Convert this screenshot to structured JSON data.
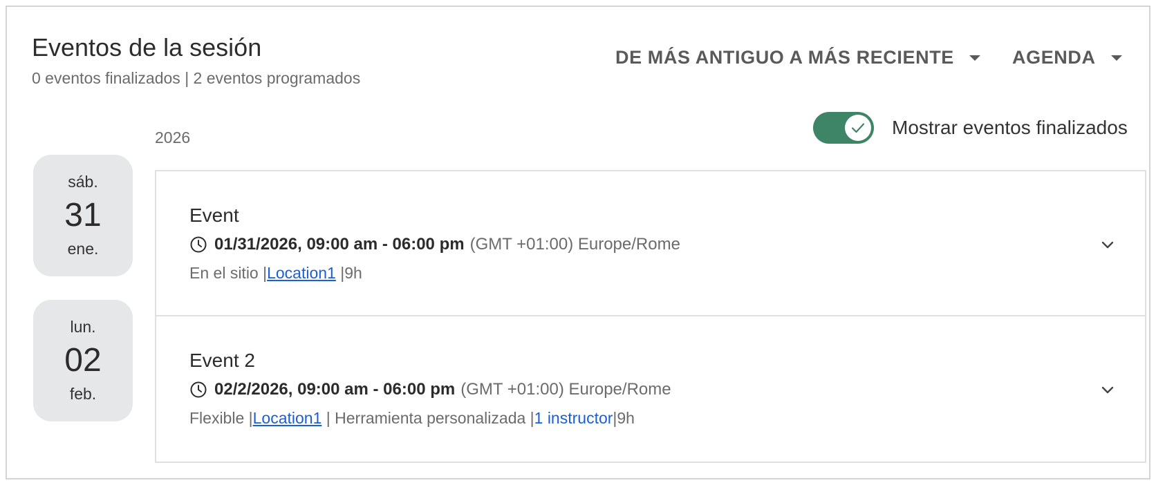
{
  "header": {
    "title": "Eventos de la sesión",
    "subtitle": "0 eventos finalizados | 2 eventos programados",
    "sort_label": "DE MÁS ANTIGUO A MÁS RECIENTE",
    "view_label": "AGENDA"
  },
  "toggle": {
    "label": "Mostrar eventos finalizados",
    "on": true,
    "color": "#3d8566"
  },
  "year": "2026",
  "colors": {
    "link": "#1a5fd6",
    "tile_bg": "#e6e7e8"
  },
  "events": [
    {
      "dow": "sáb.",
      "day": "31",
      "month": "ene.",
      "name": "Event",
      "datetime": "01/31/2026, 09:00 am - 06:00 pm",
      "timezone": "(GMT +01:00) Europe/Rome",
      "mode": "En el sitio |",
      "location": "Location1",
      "sep1": " |",
      "duration": "9h",
      "icon": "clock-icon"
    },
    {
      "dow": "lun.",
      "day": "02",
      "month": "feb.",
      "name": "Event 2",
      "datetime": "02/2/2026, 09:00 am - 06:00 pm",
      "timezone": "(GMT +01:00) Europe/Rome",
      "mode": "Flexible |",
      "location": "Location1",
      "tool": " | Herramienta personalizada |",
      "instructors": "1 instructor",
      "sep2": "|",
      "duration": "9h",
      "icon": "clock-icon"
    }
  ]
}
